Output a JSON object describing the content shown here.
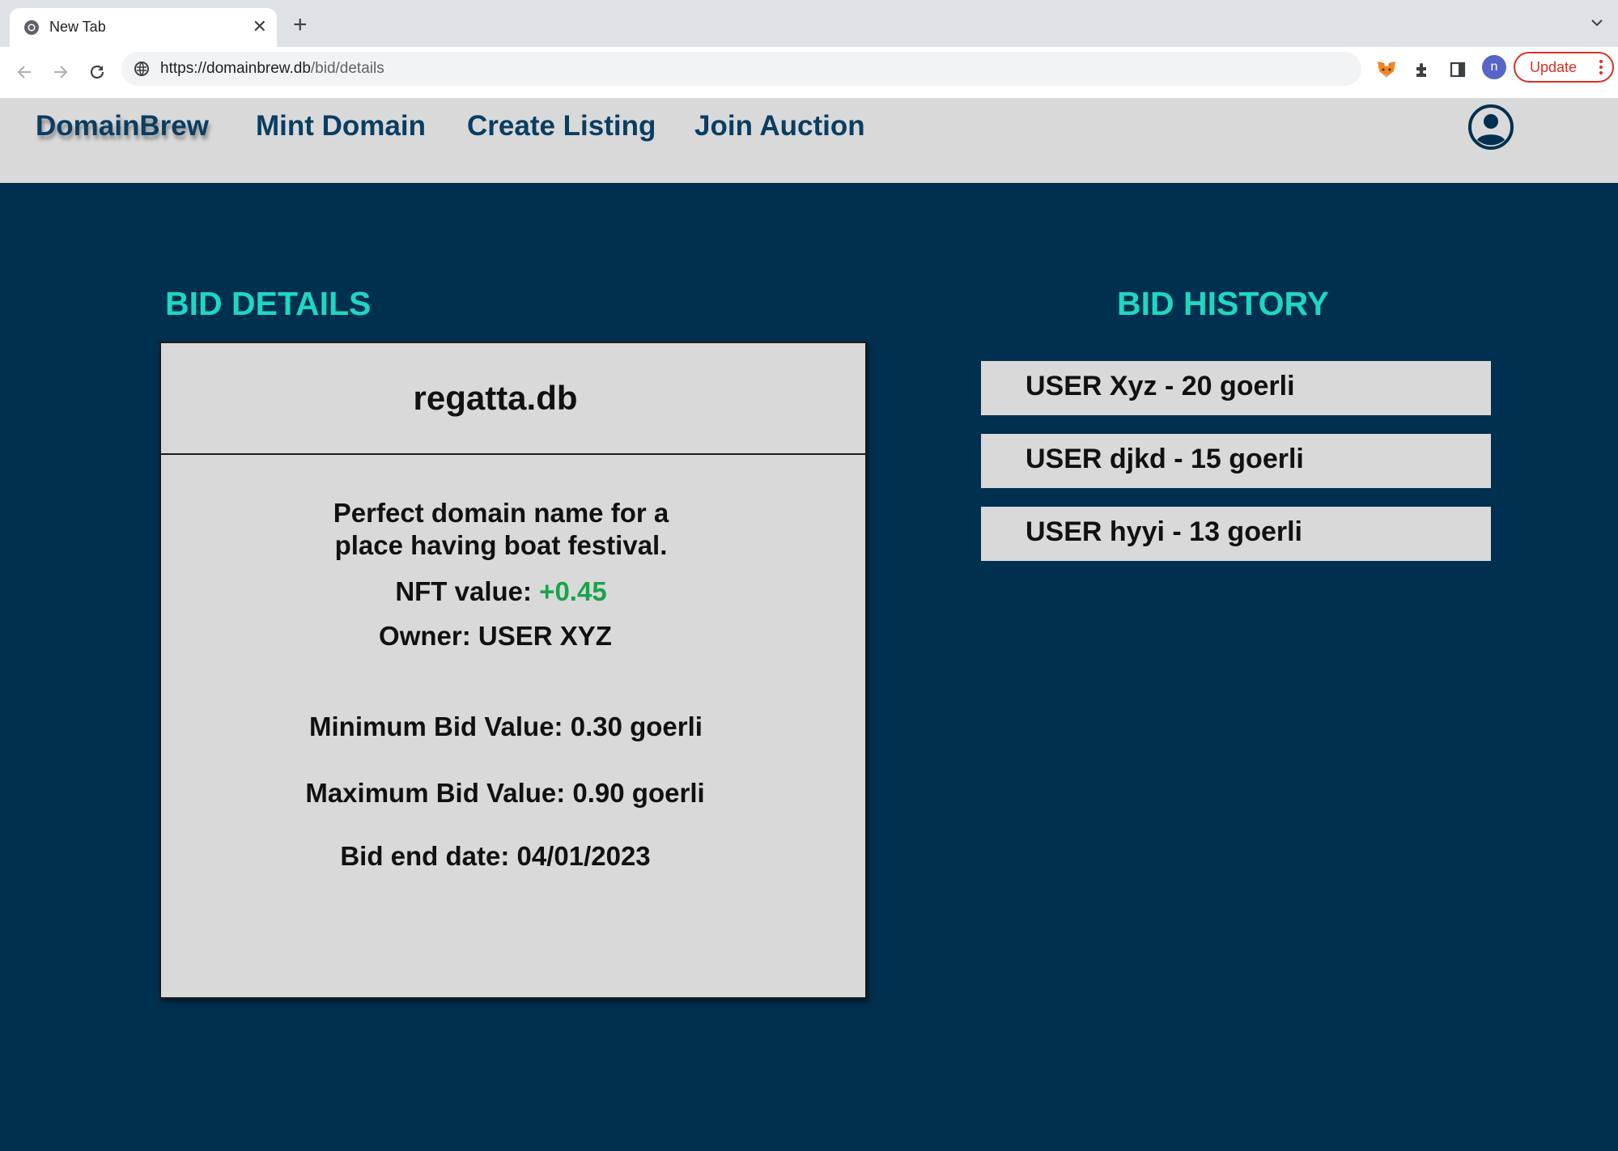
{
  "browser": {
    "tab_title": "New Tab",
    "url_host": "https://domainbrew.db",
    "url_path": "/bid/details",
    "profile_initial": "n",
    "update_label": "Update"
  },
  "site": {
    "brand": "DomainBrew",
    "nav": [
      "Mint Domain",
      "Create Listing",
      "Join Auction"
    ]
  },
  "details": {
    "heading": "BID DETAILS",
    "domain": "regatta.db",
    "description": "Perfect  domain name for a place having boat festival.",
    "nft_label": "NFT value: ",
    "nft_value": "+0.45",
    "owner": "Owner: USER XYZ",
    "min_bid": "Minimum Bid Value: 0.30 goerli",
    "max_bid": "Maximum Bid Value: 0.90 goerli",
    "end_date": "Bid end date: 04/01/2023"
  },
  "history": {
    "heading": "BID HISTORY",
    "items": [
      "USER Xyz - 20 goerli",
      "USER djkd - 15 goerli",
      "USER hyyi - 13 goerli"
    ]
  },
  "colors": {
    "navy": "#00304f",
    "teal": "#1fd7c0",
    "green": "#1aa34a",
    "card": "#d9d9d9"
  }
}
